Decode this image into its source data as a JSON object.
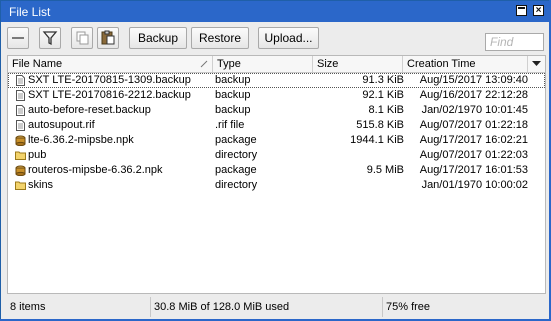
{
  "window": {
    "title": "File List"
  },
  "toolbar": {
    "backup_label": "Backup",
    "restore_label": "Restore",
    "upload_label": "Upload...",
    "find_placeholder": "Find"
  },
  "table": {
    "columns": [
      "File Name",
      "Type",
      "Size",
      "Creation Time"
    ],
    "rows": [
      {
        "name": "SXT LTE-20170815-1309.backup",
        "type": "backup",
        "size": "91.3 KiB",
        "time": "Aug/15/2017 13:09:40",
        "icon": "file-icon"
      },
      {
        "name": "SXT LTE-20170816-2212.backup",
        "type": "backup",
        "size": "92.1 KiB",
        "time": "Aug/16/2017 22:12:28",
        "icon": "file-icon"
      },
      {
        "name": "auto-before-reset.backup",
        "type": "backup",
        "size": "8.1 KiB",
        "time": "Jan/02/1970 10:01:45",
        "icon": "file-icon"
      },
      {
        "name": "autosupout.rif",
        "type": ".rif file",
        "size": "515.8 KiB",
        "time": "Aug/07/2017 01:22:18",
        "icon": "file-icon"
      },
      {
        "name": "lte-6.36.2-mipsbe.npk",
        "type": "package",
        "size": "1944.1 KiB",
        "time": "Aug/17/2017 16:02:21",
        "icon": "package-icon"
      },
      {
        "name": "pub",
        "type": "directory",
        "size": "",
        "time": "Aug/07/2017 01:22:03",
        "icon": "folder-icon"
      },
      {
        "name": "routeros-mipsbe-6.36.2.npk",
        "type": "package",
        "size": "9.5 MiB",
        "time": "Aug/17/2017 16:01:53",
        "icon": "package-icon"
      },
      {
        "name": "skins",
        "type": "directory",
        "size": "",
        "time": "Jan/01/1970 10:00:02",
        "icon": "folder-icon"
      }
    ]
  },
  "status": {
    "items": "8 items",
    "used": "30.8 MiB of 128.0 MiB used",
    "free": "75% free"
  }
}
